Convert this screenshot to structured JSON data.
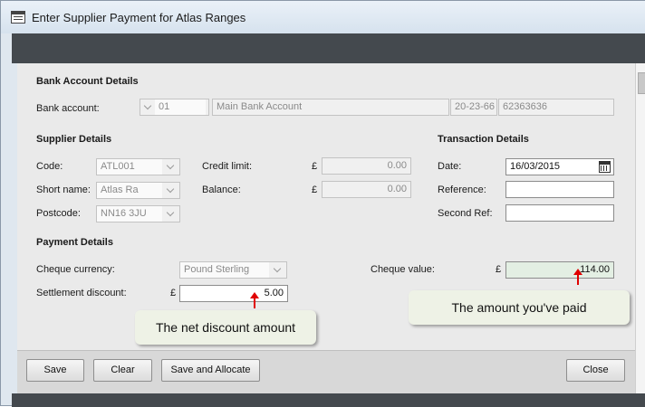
{
  "window": {
    "title": "Enter Supplier Payment for Atlas Ranges"
  },
  "bank": {
    "heading": "Bank Account Details",
    "label": "Bank account:",
    "code": "01",
    "name": "Main Bank Account",
    "sort_code": "20-23-66",
    "account_number": "62363636"
  },
  "supplier": {
    "heading": "Supplier Details",
    "code_label": "Code:",
    "code": "ATL001",
    "short_name_label": "Short name:",
    "short_name": "Atlas Ra",
    "postcode_label": "Postcode:",
    "postcode": "NN16 3JU",
    "credit_limit_label": "Credit limit:",
    "credit_limit_currency": "£",
    "credit_limit": "0.00",
    "balance_label": "Balance:",
    "balance_currency": "£",
    "balance": "0.00"
  },
  "transaction": {
    "heading": "Transaction Details",
    "date_label": "Date:",
    "date": "16/03/2015",
    "reference_label": "Reference:",
    "reference": "",
    "second_ref_label": "Second Ref:",
    "second_ref": ""
  },
  "payment": {
    "heading": "Payment Details",
    "currency_label": "Cheque currency:",
    "currency": "Pound Sterling",
    "discount_label": "Settlement discount:",
    "discount_currency": "£",
    "discount": "5.00",
    "cheque_label": "Cheque value:",
    "cheque_currency": "£",
    "cheque": "114.00"
  },
  "callouts": {
    "discount_note": "The net discount amount",
    "cheque_note": "The amount you've paid"
  },
  "buttons": {
    "save": "Save",
    "clear": "Clear",
    "save_allocate": "Save and Allocate",
    "close": "Close"
  },
  "colors": {
    "arrow": "#e00000",
    "callout_bg": "#eef2e6",
    "titlebar_dark": "#44494e"
  },
  "icons": [
    "app-window-icon",
    "calendar-icon",
    "chevron-down-icon"
  ]
}
